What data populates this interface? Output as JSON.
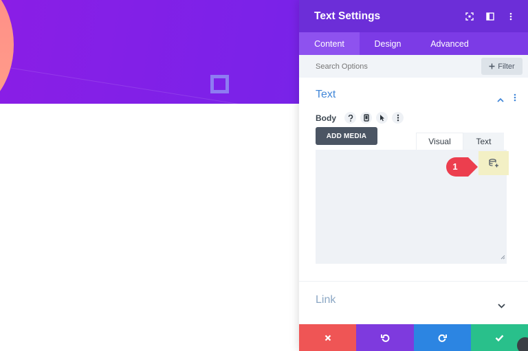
{
  "modal": {
    "title": "Text Settings",
    "tabs": [
      {
        "label": "Content"
      },
      {
        "label": "Design"
      },
      {
        "label": "Advanced"
      }
    ],
    "search": {
      "placeholder": "Search Options"
    },
    "filter": {
      "label": "Filter"
    },
    "text_section": {
      "title": "Text",
      "body_label": "Body",
      "add_media_label": "ADD MEDIA",
      "editor_tabs": [
        {
          "label": "Visual"
        },
        {
          "label": "Text"
        }
      ],
      "callout_number": "1"
    },
    "link_section": {
      "title": "Link"
    }
  },
  "colors": {
    "header": "#6c2ed8",
    "tabs_bg": "#7c3be6",
    "tab_active": "#8e52ef",
    "cancel": "#ef5555",
    "undo": "#7e3ade",
    "redo": "#2c85e2",
    "save": "#29c08b",
    "callout": "#ec3e4e",
    "dynamic_highlight": "#f3f0c5",
    "section_title": "#4287d8"
  },
  "icons": {
    "header": [
      "expand-icon",
      "sidebar-icon",
      "more-vertical-icon"
    ],
    "body_row": [
      "help-icon",
      "mobile-icon",
      "cursor-icon",
      "more-vertical-icon"
    ],
    "dynamic": "dynamic-content-icon",
    "footer": [
      "close-icon",
      "undo-icon",
      "redo-icon",
      "check-icon"
    ]
  }
}
